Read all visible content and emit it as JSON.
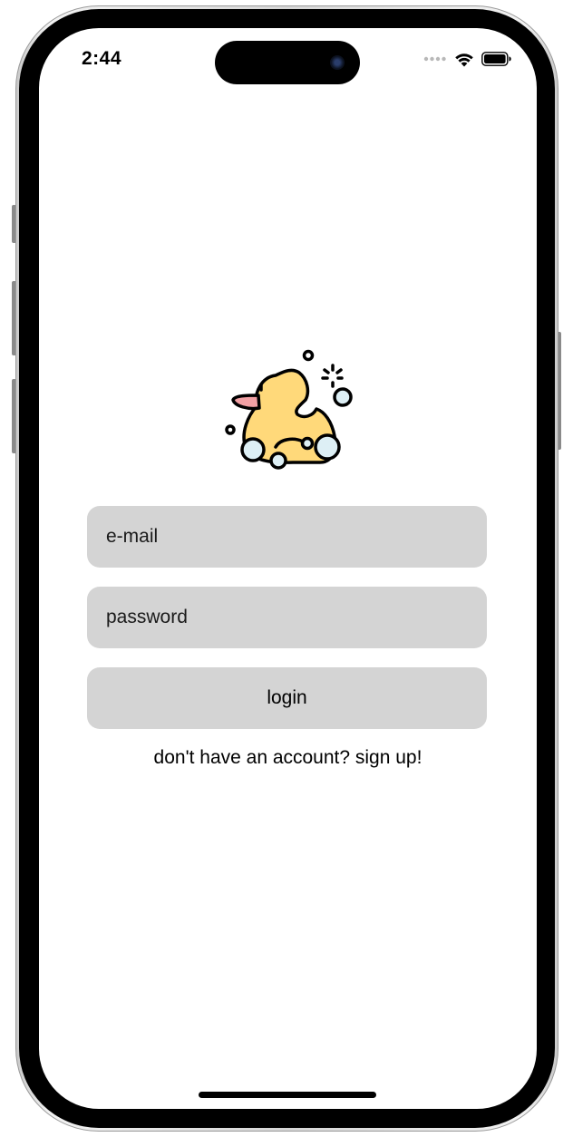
{
  "status_bar": {
    "time": "2:44",
    "icons": [
      "cellular-signal-icon",
      "wifi-icon",
      "battery-icon"
    ]
  },
  "logo": {
    "icon": "rubber-duck-icon",
    "colors": {
      "duck_body": "#FFD97A",
      "beak": "#F2A0A4",
      "bubbles": "#DDEFF5",
      "outline": "#000000"
    }
  },
  "login_form": {
    "email_placeholder": "e-mail",
    "password_placeholder": "password",
    "login_label": "login",
    "signup_text": "don't have an account? sign up!"
  },
  "colors": {
    "field_background": "#D4D4D4",
    "screen_background": "#FFFFFF",
    "text": "#000000"
  }
}
